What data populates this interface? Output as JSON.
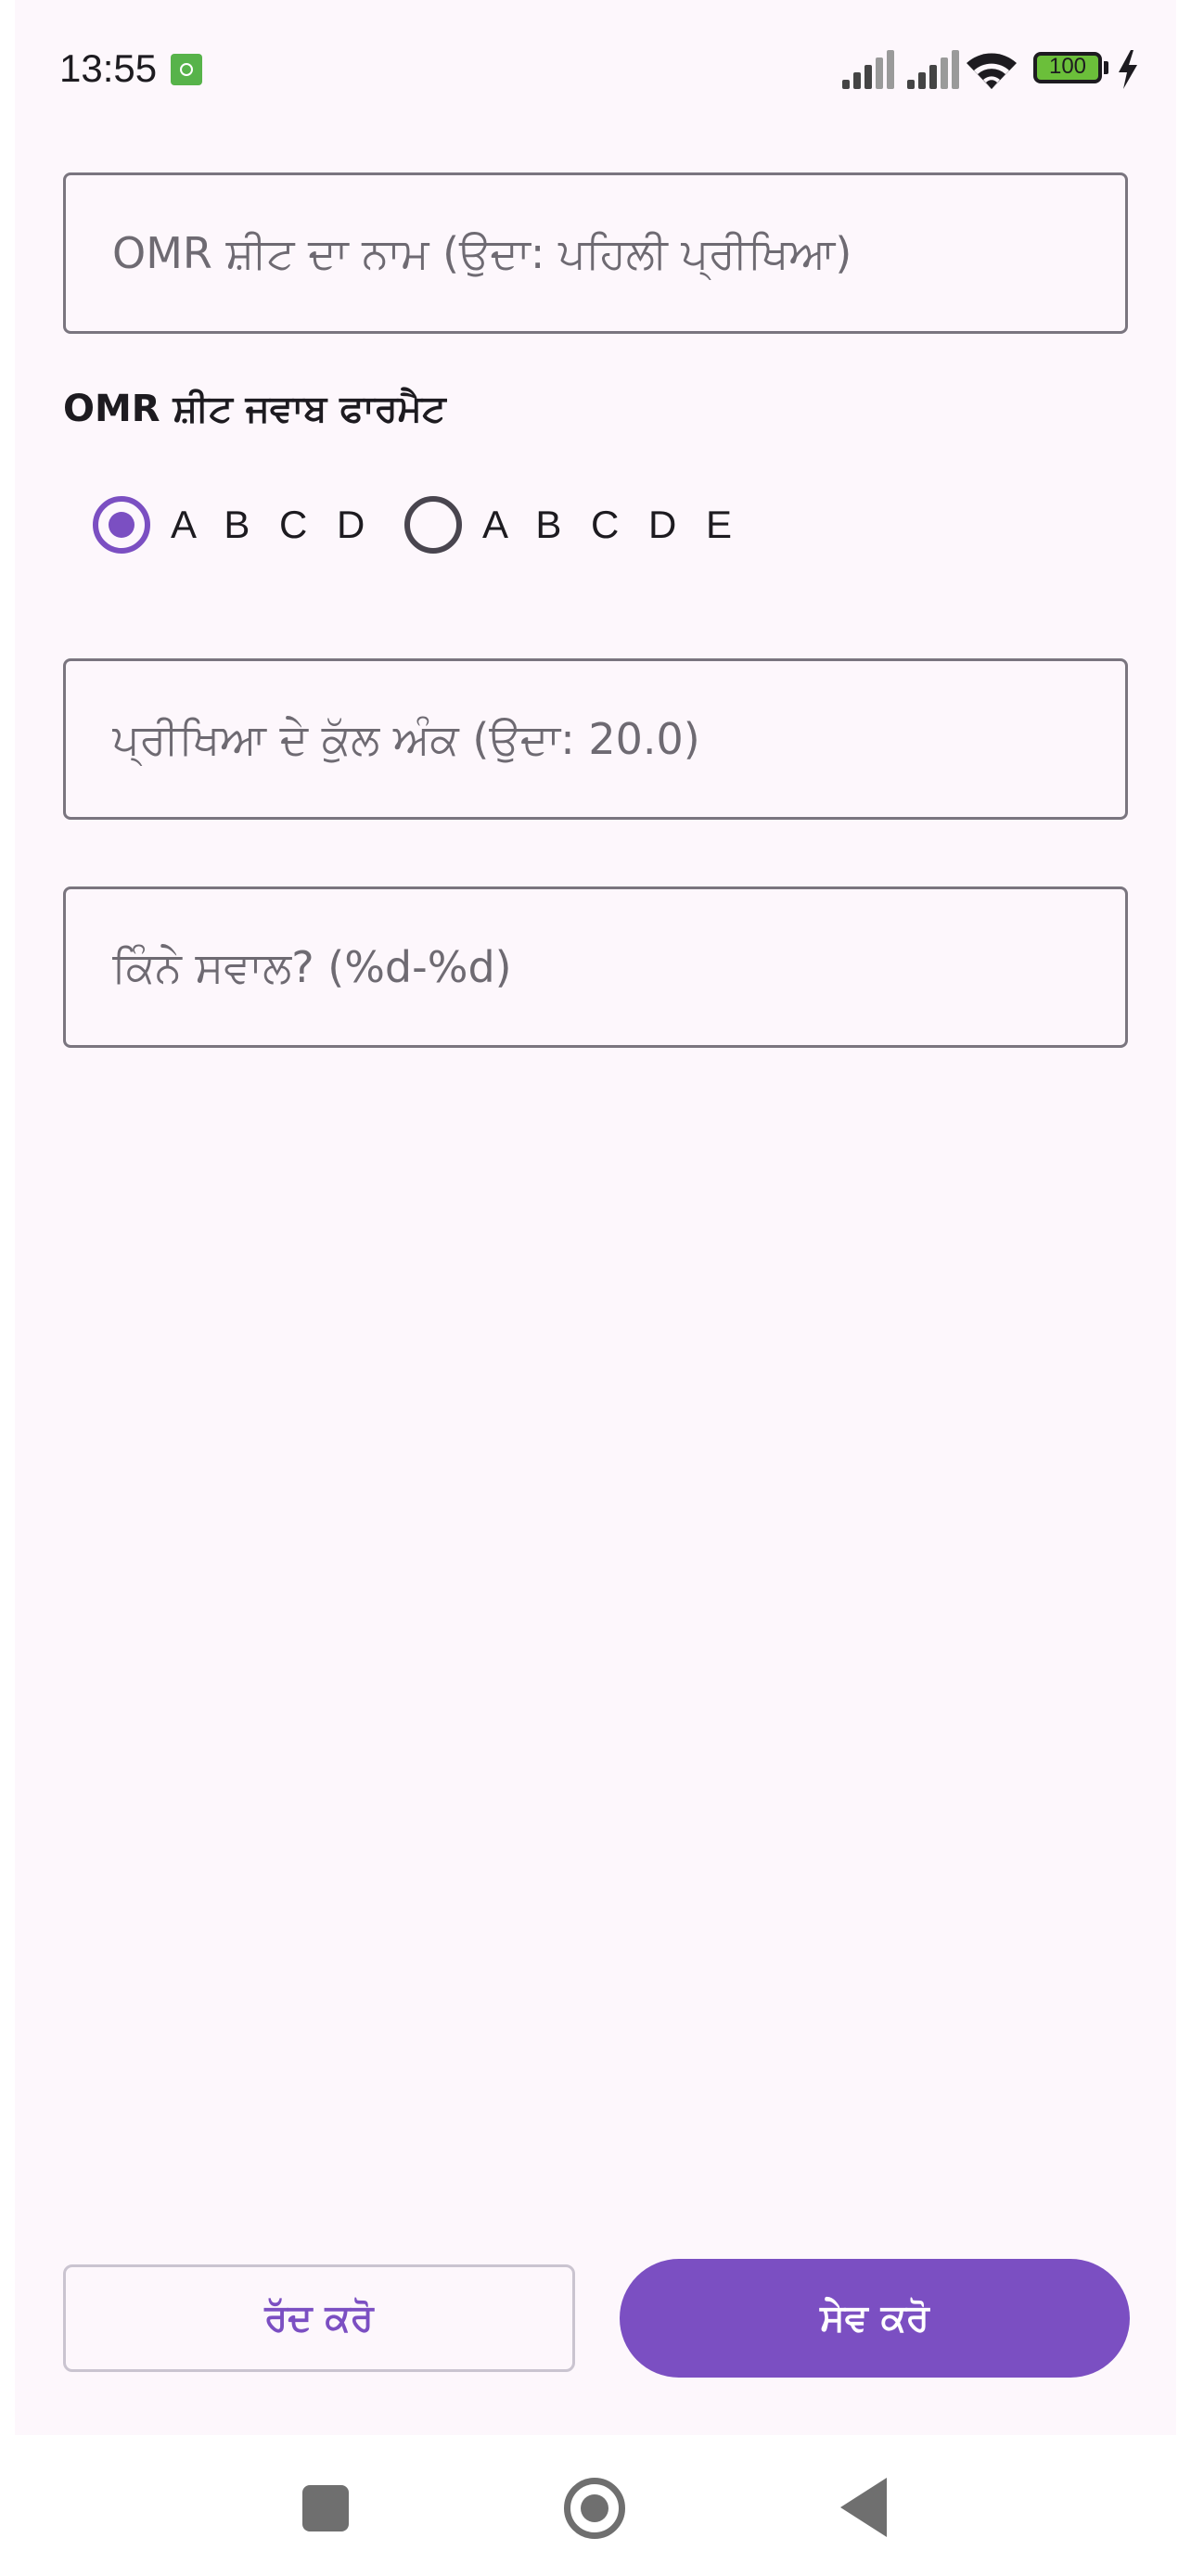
{
  "status_bar": {
    "time": "13:55",
    "battery_level": "100",
    "icons": [
      "notification-app-icon",
      "cellular-signal-icon",
      "cellular-signal-icon",
      "wifi-icon",
      "battery-icon",
      "charging-bolt-icon"
    ]
  },
  "form": {
    "sheet_name": {
      "placeholder": "OMR ਸ਼ੀਟ ਦਾ ਨਾਮ (ਉਦਾ: ਪਹਿਲੀ ਪ੍ਰੀਖਿਆ)",
      "value": ""
    },
    "answer_format": {
      "label": "OMR ਸ਼ੀਟ ਜਵਾਬ ਫਾਰਮੈਟ",
      "options": [
        {
          "label": "A B C D",
          "selected": true
        },
        {
          "label": "A B C D E",
          "selected": false
        }
      ]
    },
    "total_marks": {
      "placeholder": "ਪ੍ਰੀਖਿਆ ਦੇ ਕੁੱਲ ਅੰਕ (ਉਦਾ: 20.0)",
      "value": ""
    },
    "question_count": {
      "placeholder": "ਕਿੰਨੇ ਸਵਾਲ? (%d-%d)",
      "value": ""
    }
  },
  "actions": {
    "cancel_label": "ਰੱਦ ਕਰੋ",
    "save_label": "ਸੇਵ ਕਰੋ"
  },
  "colors": {
    "accent": "#7b4fc2",
    "background": "#fdf7fc",
    "outline": "#7a757f"
  },
  "nav_bar": {
    "icons": [
      "recents-square-icon",
      "home-circle-icon",
      "back-triangle-icon"
    ]
  }
}
